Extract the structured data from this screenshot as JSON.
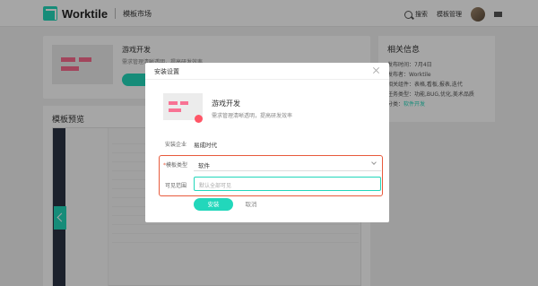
{
  "header": {
    "brand": "Worktile",
    "section": "模板市场",
    "search": "搜索",
    "manage": "模板管理"
  },
  "hero": {
    "title": "游戏开发",
    "desc": "需求管理清晰透明，提高研发效率"
  },
  "related": {
    "title": "相关信息",
    "rows": [
      {
        "label": "发布时间：",
        "value": "7月4日"
      },
      {
        "label": "发布者：",
        "value": "Worktile"
      },
      {
        "label": "相关组件：",
        "value": "表格,看板,报表,迭代"
      },
      {
        "label": "任务类型：",
        "value": "功能,BUG,优化,美术品质"
      },
      {
        "label": "分类：",
        "value": "软件开发"
      }
    ]
  },
  "preview": {
    "title": "模板预览"
  },
  "modal": {
    "title": "安装设置",
    "template_title": "游戏开发",
    "template_desc": "需求管理清晰透明，提高研发效率",
    "company_label": "安装企业",
    "company_value": "易成时代",
    "type_label": "模板类型",
    "type_value": "软件",
    "scope_label": "可见范围",
    "scope_placeholder": "默认全部可见",
    "install_label": "安装",
    "cancel_label": "取消"
  },
  "colors": {
    "accent": "#22d7bb",
    "highlight": "#e85a3c"
  }
}
